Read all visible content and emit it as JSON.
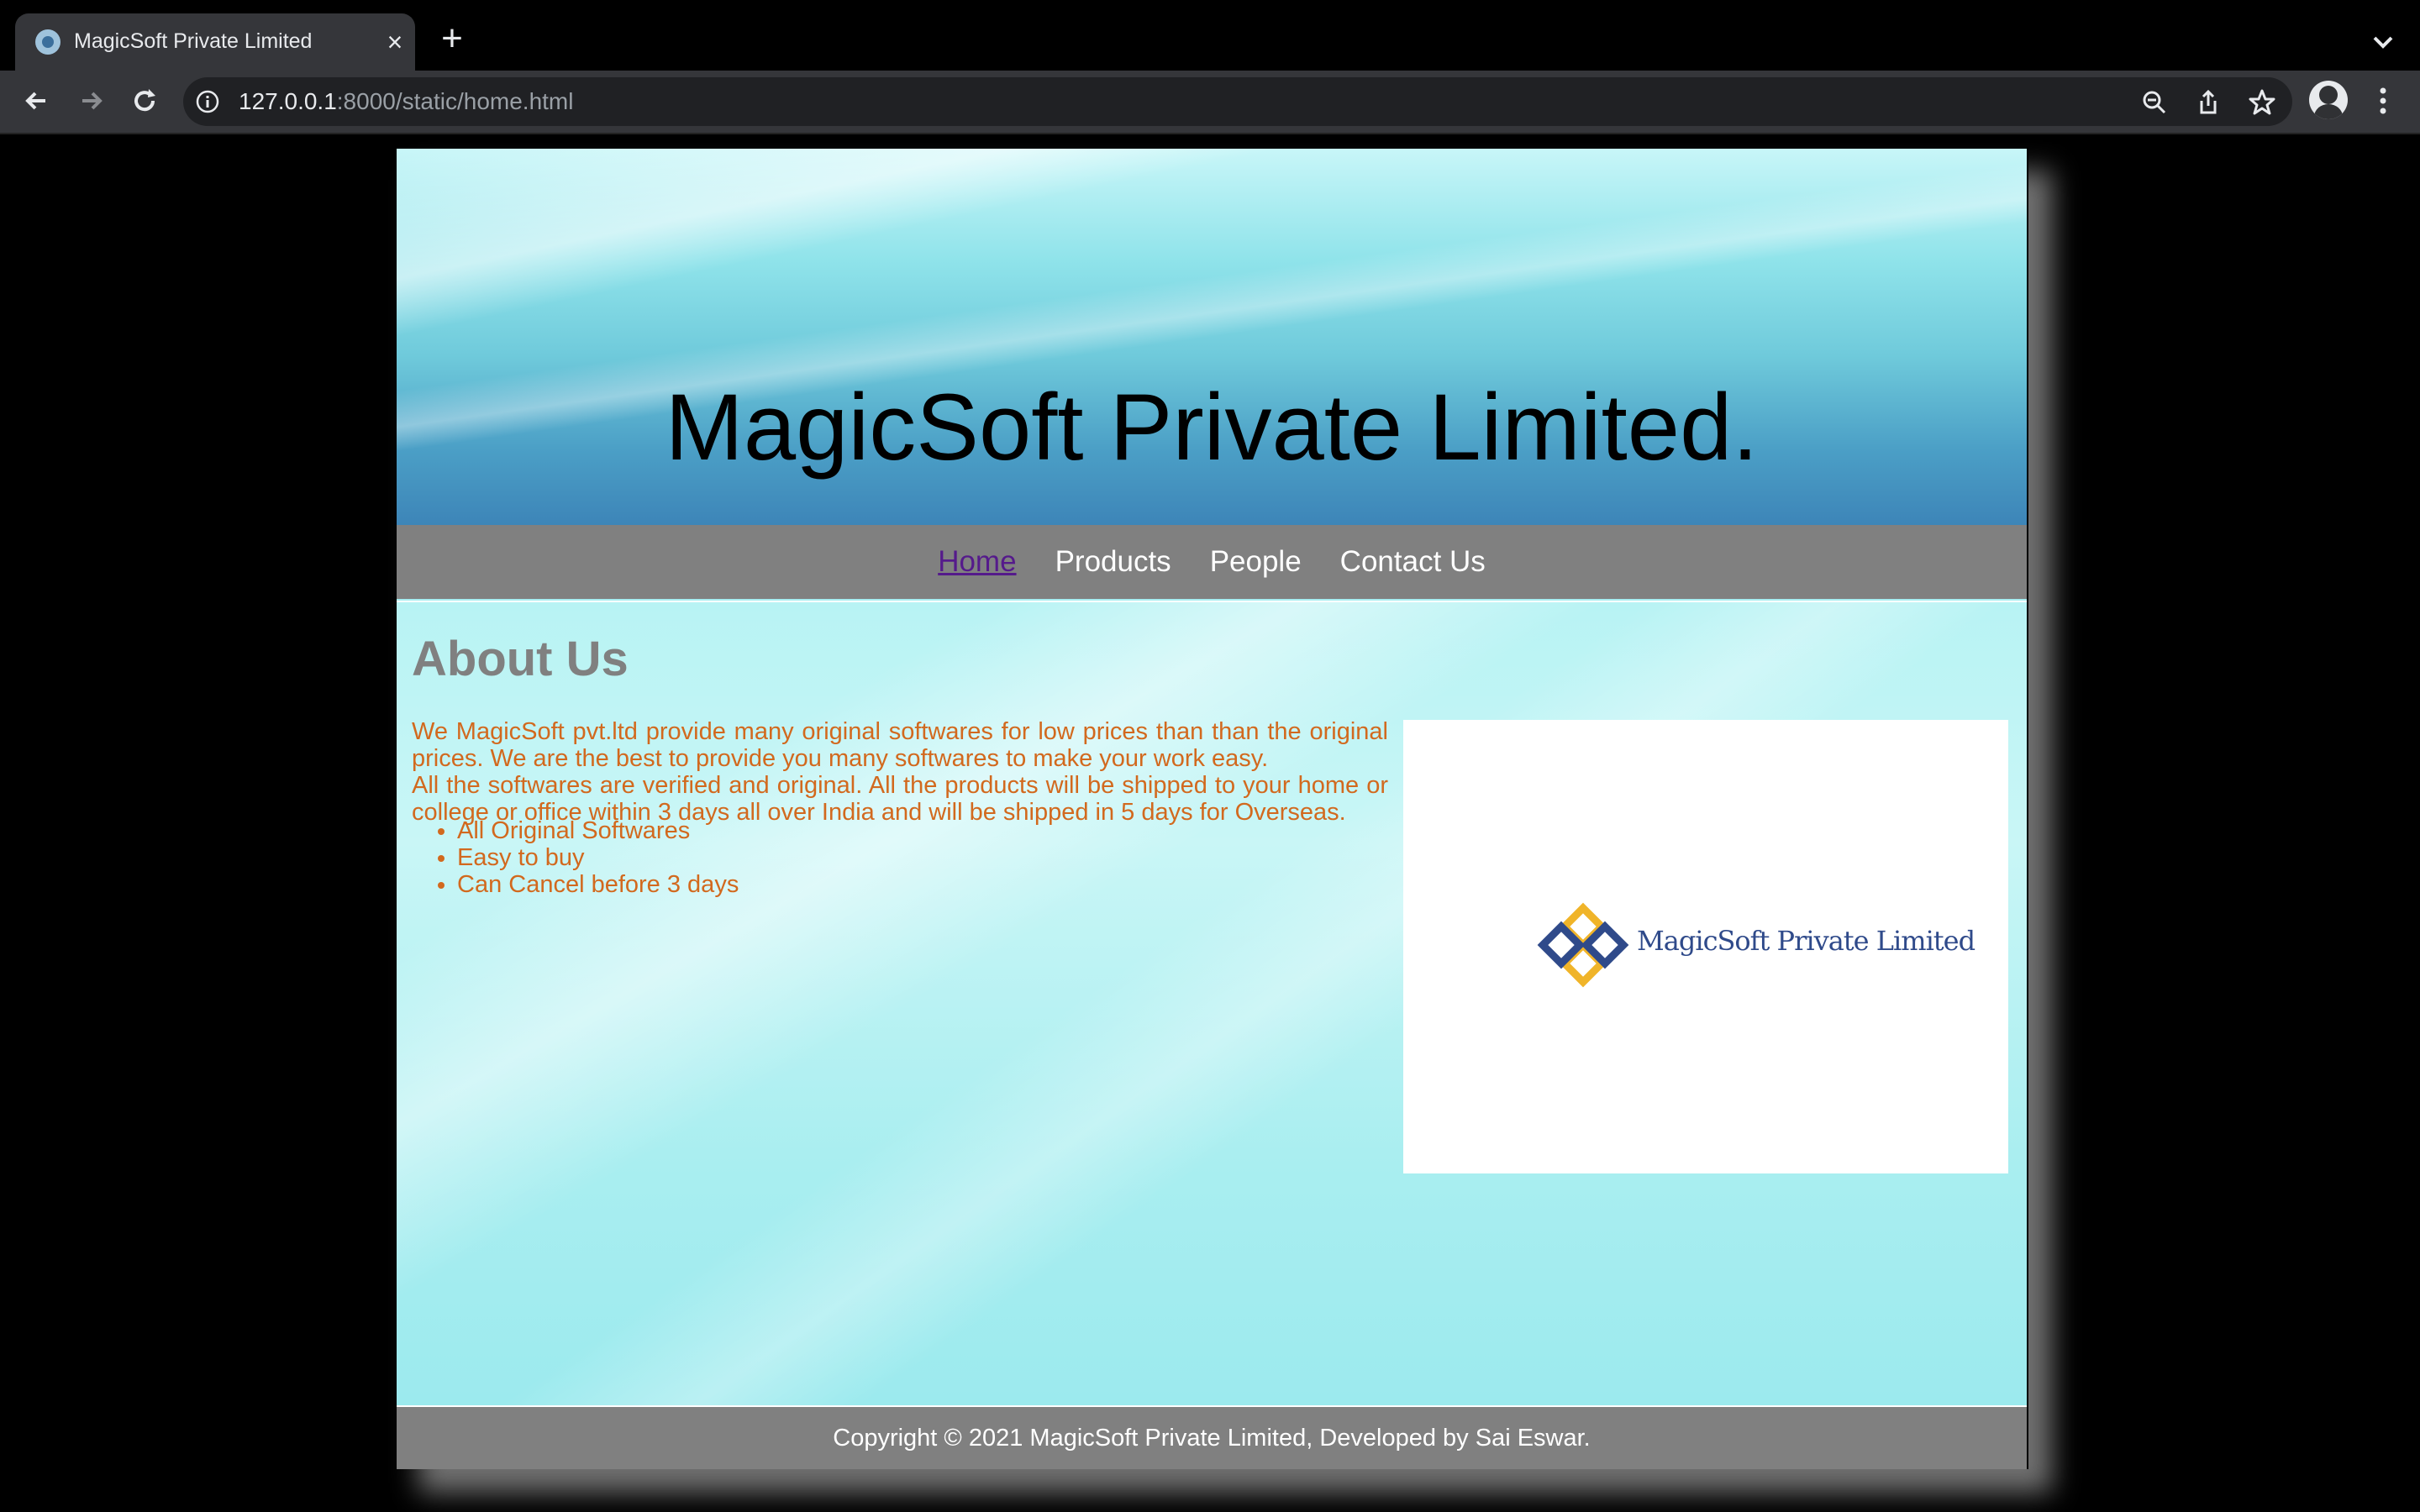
{
  "browser": {
    "tab_title": "MagicSoft Private Limited",
    "url_host": "127.0.0.1",
    "url_rest": ":8000/static/home.html",
    "icons": [
      "back-icon",
      "forward-icon",
      "reload-icon",
      "info-icon",
      "zoom-icon",
      "share-icon",
      "star-icon",
      "avatar",
      "menu-icon"
    ]
  },
  "site": {
    "title": "MagicSoft Private Limited.",
    "nav": [
      {
        "label": "Home",
        "active": true
      },
      {
        "label": "Products",
        "active": false
      },
      {
        "label": "People",
        "active": false
      },
      {
        "label": "Contact Us",
        "active": false
      }
    ],
    "about": {
      "heading": "About Us",
      "para1": "We MagicSoft pvt.ltd provide many original softwares for low prices than than the original prices. We are the best to provide you many softwares to make your work easy.",
      "para2": "All the softwares are verified and original. All the products will be shipped to your home or college or office within 3 days all over India and will be shipped in 5 days for Overseas.",
      "features": [
        "All Original Softwares",
        "Easy to buy",
        "Can Cancel before 3 days"
      ]
    },
    "logo_text": "MagicSoft Private Limited",
    "footer": "Copyright © 2021 MagicSoft Private Limited, Developed by Sai Eswar.",
    "colors": {
      "nav_bg": "#808080",
      "text_accent": "#d2691e",
      "heading": "#808080",
      "logo_blue": "#2f4a8a",
      "logo_gold": "#f0b429"
    }
  }
}
